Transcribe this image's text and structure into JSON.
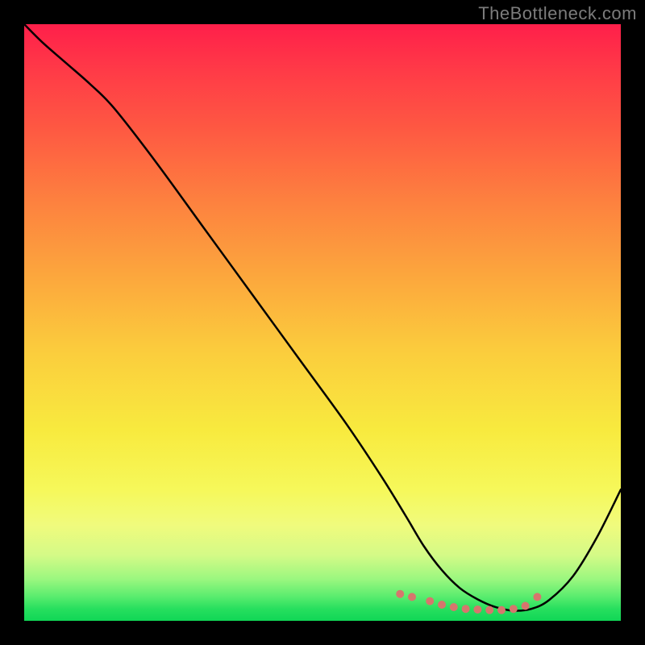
{
  "watermark": "TheBottleneck.com",
  "chart_data": {
    "type": "line",
    "title": "",
    "xlabel": "",
    "ylabel": "",
    "xlim": [
      0,
      100
    ],
    "ylim": [
      0,
      100
    ],
    "curve": {
      "x": [
        0,
        3,
        7,
        11,
        15,
        22,
        30,
        38,
        46,
        54,
        60,
        64,
        67,
        70,
        73,
        76,
        79,
        82,
        85,
        88,
        92,
        96,
        100
      ],
      "y": [
        100,
        97,
        93.5,
        90,
        86,
        77,
        66,
        55,
        44,
        33,
        24,
        17.5,
        12.5,
        8.5,
        5.5,
        3.6,
        2.3,
        1.7,
        2,
        3.5,
        7.5,
        14,
        22
      ]
    },
    "highlight_points": {
      "x": [
        63,
        65,
        68,
        70,
        72,
        74,
        76,
        78,
        80,
        82,
        84,
        86
      ],
      "y": [
        4.5,
        4.0,
        3.3,
        2.7,
        2.3,
        2.0,
        1.9,
        1.8,
        1.8,
        2.0,
        2.5,
        4.0
      ],
      "color": "#d6766d",
      "radius": 5
    },
    "series": [
      {
        "name": "bottleneck-curve",
        "color": "#000000"
      }
    ]
  }
}
